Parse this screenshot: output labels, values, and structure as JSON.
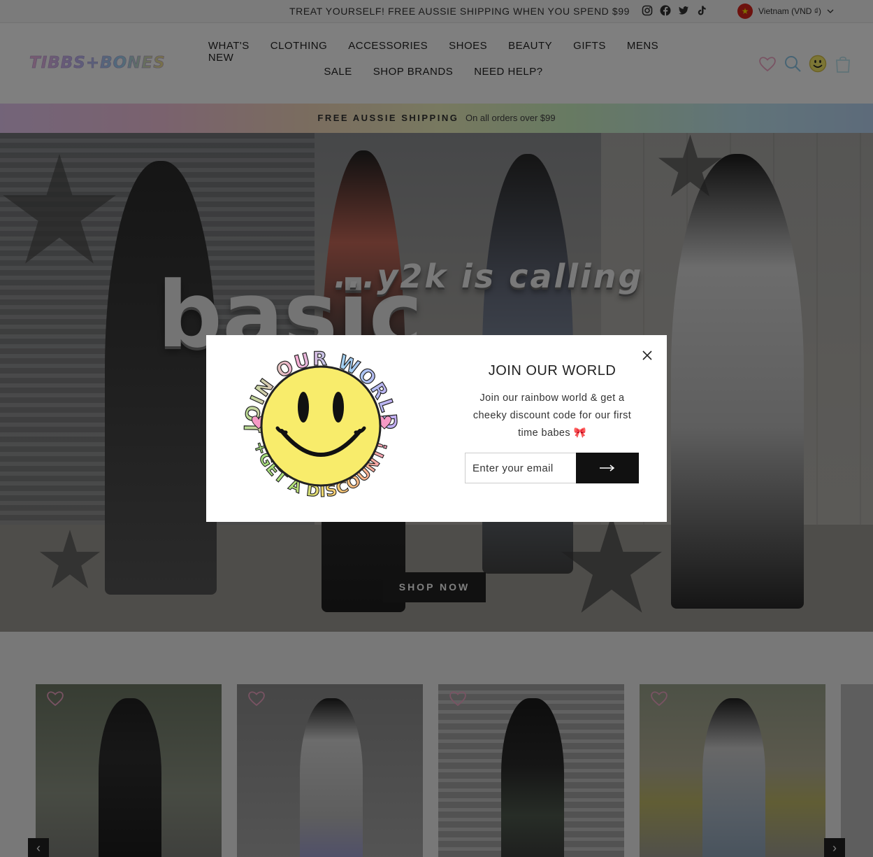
{
  "announcement": {
    "promo": "TREAT YOURSELF! FREE AUSSIE SHIPPING WHEN YOU SPEND $99",
    "social_icons": [
      "instagram-icon",
      "facebook-icon",
      "twitter-icon",
      "tiktok-icon"
    ],
    "locale_label": "Vietnam (VND ₫)",
    "flag_symbol": "★"
  },
  "header": {
    "logo": "TIBBS+BONES",
    "nav_row1": [
      "WHAT'S NEW",
      "CLOTHING",
      "ACCESSORIES",
      "SHOES",
      "BEAUTY",
      "GIFTS",
      "MENS"
    ],
    "nav_row2": [
      "SALE",
      "SHOP BRANDS",
      "NEED HELP?"
    ],
    "icons": [
      "wishlist-heart-icon",
      "search-icon",
      "account-smiley-icon",
      "cart-bag-icon"
    ]
  },
  "rainbow_banner": {
    "headline": "FREE AUSSIE SHIPPING",
    "subtext": "On all orders over $99"
  },
  "hero": {
    "slogan": "...y2k is calling",
    "big_word": "basic",
    "cta": "SHOP NOW"
  },
  "carousel": {
    "prev_symbol": "‹",
    "next_symbol": "›",
    "cards": 4
  },
  "modal": {
    "badge_text": "JOIN OUR WORLD +GET A DISCOUNT!",
    "title": "JOIN OUR WORLD",
    "body": "Join our rainbow world & get a cheeky discount code for our first time babes 🎀",
    "email_placeholder": "Enter your email",
    "submit_icon": "arrow-right-icon",
    "close_icon": "close-icon"
  },
  "colors": {
    "overlay": "rgba(0,0,0,0.5)",
    "button": "#222222",
    "smiley_yellow": "#f8ec6b"
  }
}
